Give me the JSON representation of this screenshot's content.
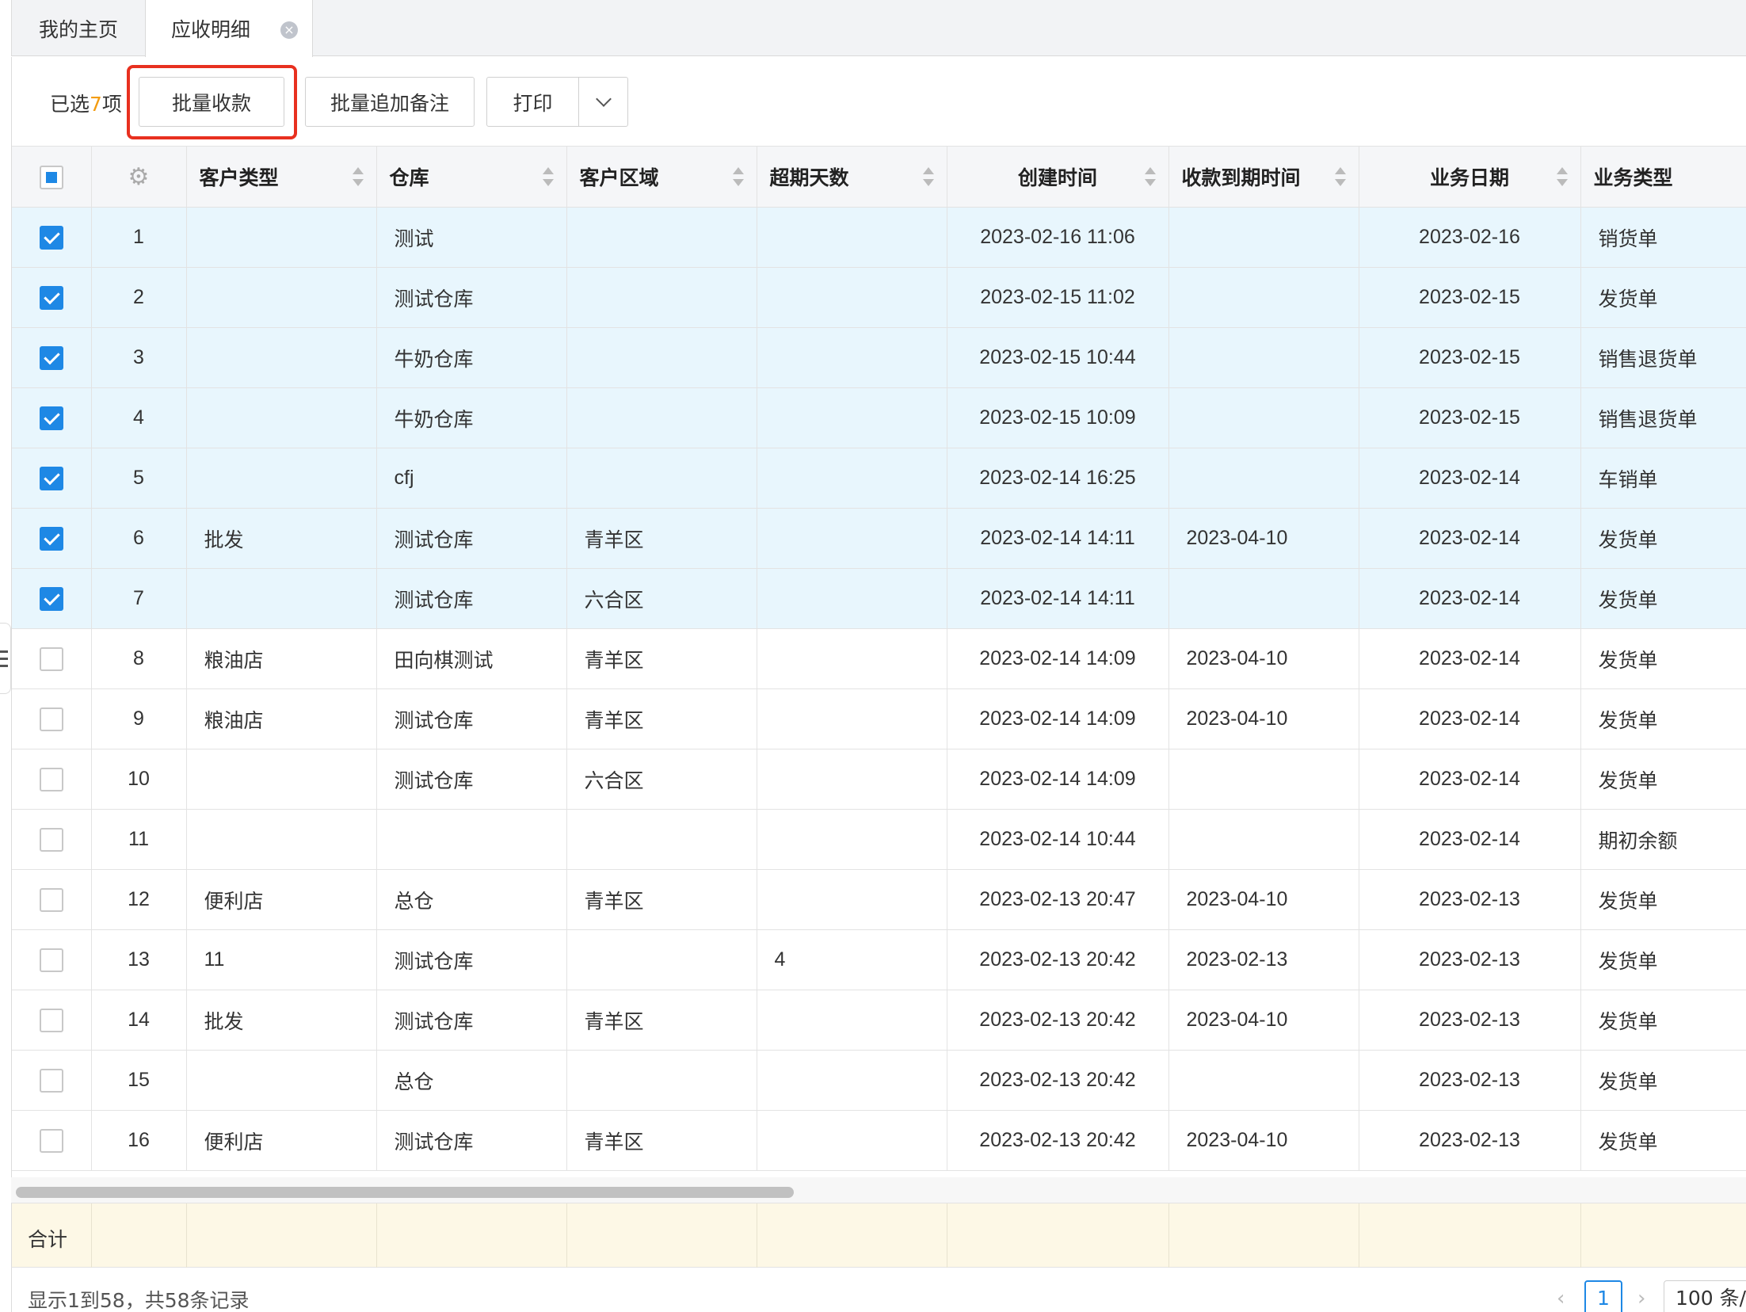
{
  "tabs": {
    "home_label": "我的主页",
    "active_label": "应收明细",
    "close_icon": "×"
  },
  "toolbar": {
    "selected_prefix": "已选",
    "selected_count": "7",
    "selected_suffix": "项",
    "batch_collect_label": "批量收款",
    "batch_remark_label": "批量追加备注",
    "print_label": "打印"
  },
  "table": {
    "columns": [
      "客户类型",
      "仓库",
      "客户区域",
      "超期天数",
      "创建时间",
      "收款到期时间",
      "业务日期",
      "业务类型"
    ],
    "rows": [
      {
        "no": "1",
        "checked": true,
        "customer_type": "",
        "warehouse": "测试",
        "region": "",
        "overdue": "",
        "created": "2023-02-16 11:06",
        "due": "",
        "biz_date": "2023-02-16",
        "biz_type": "销货单"
      },
      {
        "no": "2",
        "checked": true,
        "customer_type": "",
        "warehouse": "测试仓库",
        "region": "",
        "overdue": "",
        "created": "2023-02-15 11:02",
        "due": "",
        "biz_date": "2023-02-15",
        "biz_type": "发货单"
      },
      {
        "no": "3",
        "checked": true,
        "customer_type": "",
        "warehouse": "牛奶仓库",
        "region": "",
        "overdue": "",
        "created": "2023-02-15 10:44",
        "due": "",
        "biz_date": "2023-02-15",
        "biz_type": "销售退货单"
      },
      {
        "no": "4",
        "checked": true,
        "customer_type": "",
        "warehouse": "牛奶仓库",
        "region": "",
        "overdue": "",
        "created": "2023-02-15 10:09",
        "due": "",
        "biz_date": "2023-02-15",
        "biz_type": "销售退货单"
      },
      {
        "no": "5",
        "checked": true,
        "customer_type": "",
        "warehouse": "cfj",
        "region": "",
        "overdue": "",
        "created": "2023-02-14 16:25",
        "due": "",
        "biz_date": "2023-02-14",
        "biz_type": "车销单"
      },
      {
        "no": "6",
        "checked": true,
        "customer_type": "批发",
        "warehouse": "测试仓库",
        "region": "青羊区",
        "overdue": "",
        "created": "2023-02-14 14:11",
        "due": "2023-04-10",
        "biz_date": "2023-02-14",
        "biz_type": "发货单"
      },
      {
        "no": "7",
        "checked": true,
        "customer_type": "",
        "warehouse": "测试仓库",
        "region": "六合区",
        "overdue": "",
        "created": "2023-02-14 14:11",
        "due": "",
        "biz_date": "2023-02-14",
        "biz_type": "发货单"
      },
      {
        "no": "8",
        "checked": false,
        "customer_type": "粮油店",
        "warehouse": "田向棋测试",
        "region": "青羊区",
        "overdue": "",
        "created": "2023-02-14 14:09",
        "due": "2023-04-10",
        "biz_date": "2023-02-14",
        "biz_type": "发货单"
      },
      {
        "no": "9",
        "checked": false,
        "customer_type": "粮油店",
        "warehouse": "测试仓库",
        "region": "青羊区",
        "overdue": "",
        "created": "2023-02-14 14:09",
        "due": "2023-04-10",
        "biz_date": "2023-02-14",
        "biz_type": "发货单"
      },
      {
        "no": "10",
        "checked": false,
        "customer_type": "",
        "warehouse": "测试仓库",
        "region": "六合区",
        "overdue": "",
        "created": "2023-02-14 14:09",
        "due": "",
        "biz_date": "2023-02-14",
        "biz_type": "发货单"
      },
      {
        "no": "11",
        "checked": false,
        "customer_type": "",
        "warehouse": "",
        "region": "",
        "overdue": "",
        "created": "2023-02-14 10:44",
        "due": "",
        "biz_date": "2023-02-14",
        "biz_type": "期初余额"
      },
      {
        "no": "12",
        "checked": false,
        "customer_type": "便利店",
        "warehouse": "总仓",
        "region": "青羊区",
        "overdue": "",
        "created": "2023-02-13 20:47",
        "due": "2023-04-10",
        "biz_date": "2023-02-13",
        "biz_type": "发货单"
      },
      {
        "no": "13",
        "checked": false,
        "customer_type": "11",
        "warehouse": "测试仓库",
        "region": "",
        "overdue": "4",
        "created": "2023-02-13 20:42",
        "due": "2023-02-13",
        "biz_date": "2023-02-13",
        "biz_type": "发货单"
      },
      {
        "no": "14",
        "checked": false,
        "customer_type": "批发",
        "warehouse": "测试仓库",
        "region": "青羊区",
        "overdue": "",
        "created": "2023-02-13 20:42",
        "due": "2023-04-10",
        "biz_date": "2023-02-13",
        "biz_type": "发货单"
      },
      {
        "no": "15",
        "checked": false,
        "customer_type": "",
        "warehouse": "总仓",
        "region": "",
        "overdue": "",
        "created": "2023-02-13 20:42",
        "due": "",
        "biz_date": "2023-02-13",
        "biz_type": "发货单"
      },
      {
        "no": "16",
        "checked": false,
        "customer_type": "便利店",
        "warehouse": "测试仓库",
        "region": "青羊区",
        "overdue": "",
        "created": "2023-02-13 20:42",
        "due": "2023-04-10",
        "biz_date": "2023-02-13",
        "biz_type": "发货单"
      }
    ]
  },
  "footer": {
    "sum_label": "合计",
    "records_info": "显示1到58，共58条记录",
    "current_page": "1",
    "page_size": "100 条/"
  },
  "icons": {
    "settings": "gear-icon",
    "sort": "sort-icon",
    "chevron": "chevron-down-icon",
    "prev": "‹",
    "next": "›"
  },
  "colors": {
    "accent": "#1e88e5",
    "highlight_border": "#e8301f",
    "selected_row": "#e8f6fd",
    "count": "#f39c12",
    "sum_row": "#fdf8e6"
  }
}
